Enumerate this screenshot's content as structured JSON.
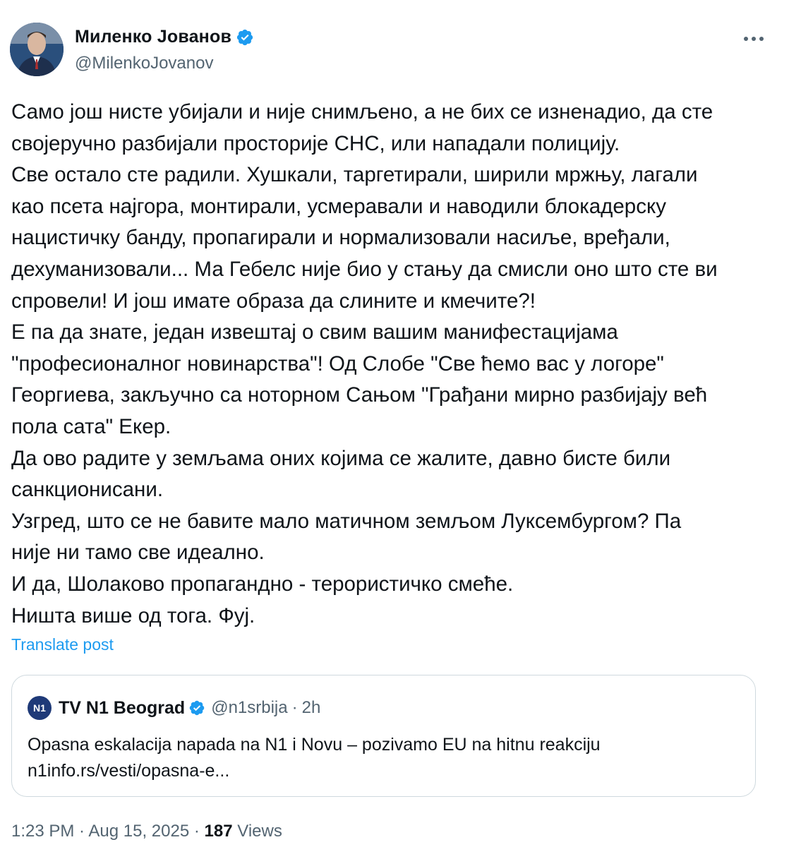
{
  "author": {
    "display_name": "Миленко Јованов",
    "handle": "@MilenkoJovanov",
    "verified_color": "#1d9bf0"
  },
  "more_icon": "more-horizontal-icon",
  "body_lines": [
    "Само још нисте убијали и није снимљено, а не бих се изненадио, да сте",
    "својеручно разбијали просторије СНС, или нападали полицију.",
    "Све остало сте радили. Хушкали, таргетирали, ширили мржњу, лагали",
    "као псета најгора, монтирали, усмеравали и наводили блокадерску",
    "нацистичку банду, пропагирали и нормализовали насиље, вређали,",
    "дехуманизовали... Ма Гебелс није био у стању да смисли оно што сте ви",
    "спровели! И још имате образа да слините и кмечите?!",
    "Е па да знате, један извештај о свим вашим манифестацијама",
    "\"професионалног новинарства\"! Од Слобе \"Све  ћемо вас у логоре\"",
    "Георгиева, закључно са ноторном Сањом \"Грађани мирно разбијају већ",
    "пола сата\" Екер.",
    "Да ово радите у земљама оних којима се жалите, давно бисте били",
    "санкционисани.",
    "Узгред, што се не бавите мало матичном земљом Луксембургом? Па",
    "није ни тамо све идеално.",
    "И да, Шолаково пропагандно - терористичко смеће.",
    "Ништа више од тога. Фуј."
  ],
  "translate_label": "Translate post",
  "quote": {
    "logo_text": "N1",
    "name": "TV N1 Beograd",
    "handle": "@n1srbija",
    "separator": "·",
    "time": "2h",
    "text_lines": [
      "Opasna eskalacija napada na N1 i Novu – pozivamo EU na hitnu reakciju",
      "n1info.rs/vesti/opasna-e..."
    ]
  },
  "meta": {
    "time": "1:23 PM",
    "sep1": " · ",
    "date": "Aug 15, 2025",
    "sep2": " · ",
    "views_count": "187",
    "views_label": " Views"
  },
  "colors": {
    "text": "#0f1419",
    "secondary": "#536471",
    "link": "#1d9bf0",
    "border": "#cfd9de"
  }
}
